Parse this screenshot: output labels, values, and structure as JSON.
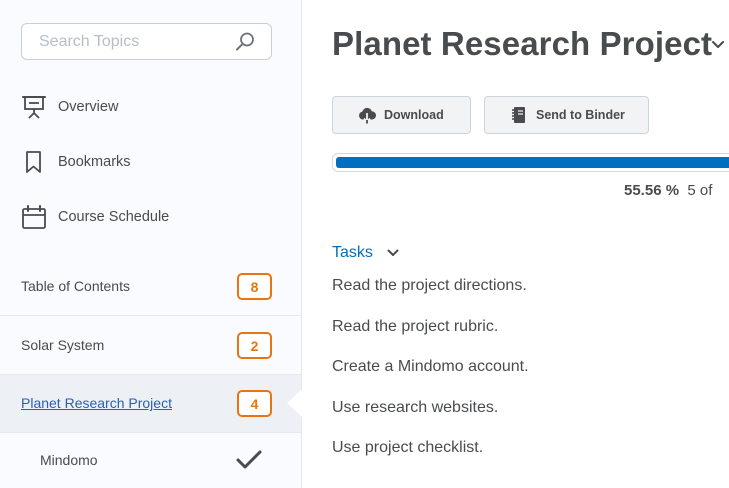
{
  "sidebar": {
    "search": {
      "placeholder": "Search Topics"
    },
    "nav": [
      {
        "label": "Overview",
        "icon": "presentation-icon"
      },
      {
        "label": "Bookmarks",
        "icon": "bookmark-icon"
      },
      {
        "label": "Course Schedule",
        "icon": "calendar-icon"
      }
    ],
    "toc": [
      {
        "label": "Table of Contents",
        "badge": "8"
      },
      {
        "label": "Solar System",
        "badge": "2"
      },
      {
        "label": "Planet Research Project",
        "badge": "4",
        "selected": true
      }
    ],
    "sub_item": {
      "label": "Mindomo",
      "icon": "checkmark-icon"
    }
  },
  "main": {
    "title": "Planet Research Project",
    "buttons": {
      "download": "Download",
      "binder": "Send to Binder"
    },
    "progress": {
      "percent_label": "55.56 %",
      "count_label": "5 of",
      "value": 55.56
    },
    "tasks": {
      "title": "Tasks",
      "items": [
        "Read the project directions.",
        "Read the project rubric.",
        "Create a Mindomo account.",
        "Use research websites.",
        "Use project checklist."
      ]
    }
  },
  "colors": {
    "accent": "#006fbf",
    "badge": "#e87511",
    "text": "#494c4e"
  }
}
